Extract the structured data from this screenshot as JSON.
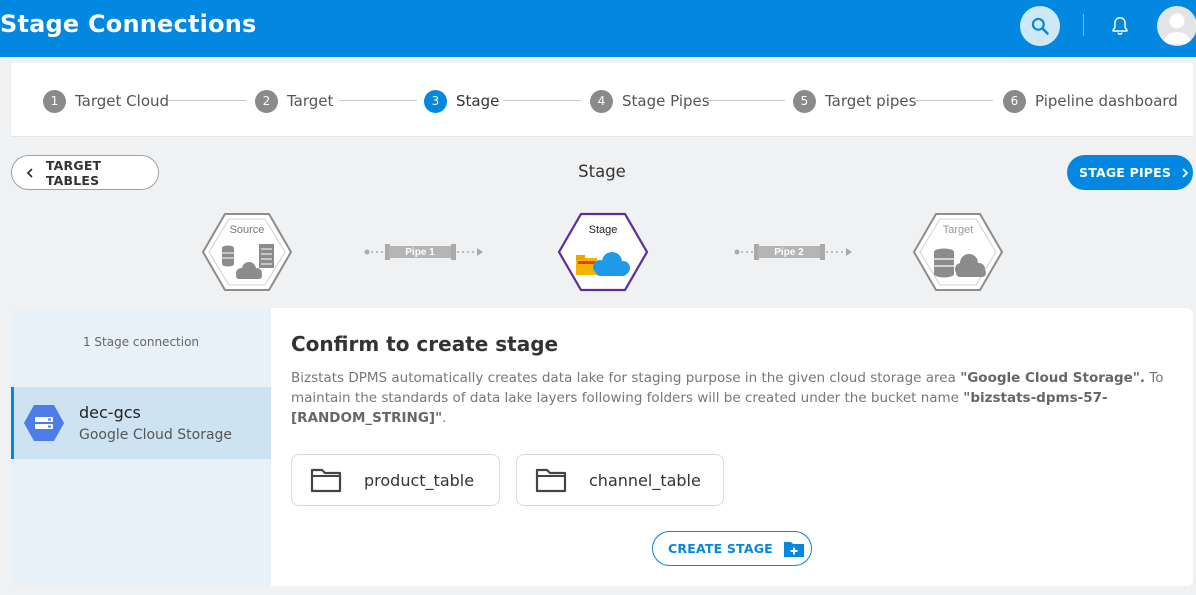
{
  "header": {
    "title": "Stage Connections",
    "icons": [
      "search-icon",
      "bell-icon",
      "user-avatar-icon"
    ],
    "color": "#0288e0"
  },
  "stepper": {
    "steps": [
      {
        "num": "1",
        "label": "Target Cloud",
        "active": false
      },
      {
        "num": "2",
        "label": "Target",
        "active": false
      },
      {
        "num": "3",
        "label": "Stage",
        "active": true
      },
      {
        "num": "4",
        "label": "Stage Pipes",
        "active": false
      },
      {
        "num": "5",
        "label": "Target pipes",
        "active": false
      },
      {
        "num": "6",
        "label": "Pipeline dashboard",
        "active": false
      }
    ]
  },
  "nav": {
    "back_label": "TARGET TABLES",
    "heading": "Stage",
    "next_label": "STAGE PIPES"
  },
  "flow": {
    "source_label": "Source",
    "pipe1_label": "Pipe 1",
    "stage_label": "Stage",
    "pipe2_label": "Pipe 2",
    "target_label": "Target",
    "stage_border_color": "#5b2d9e"
  },
  "sidebar": {
    "count_label": "1 Stage connection",
    "item": {
      "name": "dec-gcs",
      "type": "Google Cloud Storage",
      "icon": "google-cloud-storage-icon"
    }
  },
  "main": {
    "title": "Confirm to create stage",
    "desc_part1": "Bizstats DPMS automatically creates data lake for staging purpose in the given cloud storage area ",
    "desc_bold1": "\"Google Cloud Storage\".",
    "desc_part2": "  To maintain the standards of data lake layers following folders will be created under the bucket name ",
    "desc_bold2": "\"bizstats-dpms-57-[RANDOM_STRING]\"",
    "desc_part3": ".",
    "folders": [
      "product_table",
      "channel_table"
    ],
    "create_label": "CREATE STAGE"
  }
}
